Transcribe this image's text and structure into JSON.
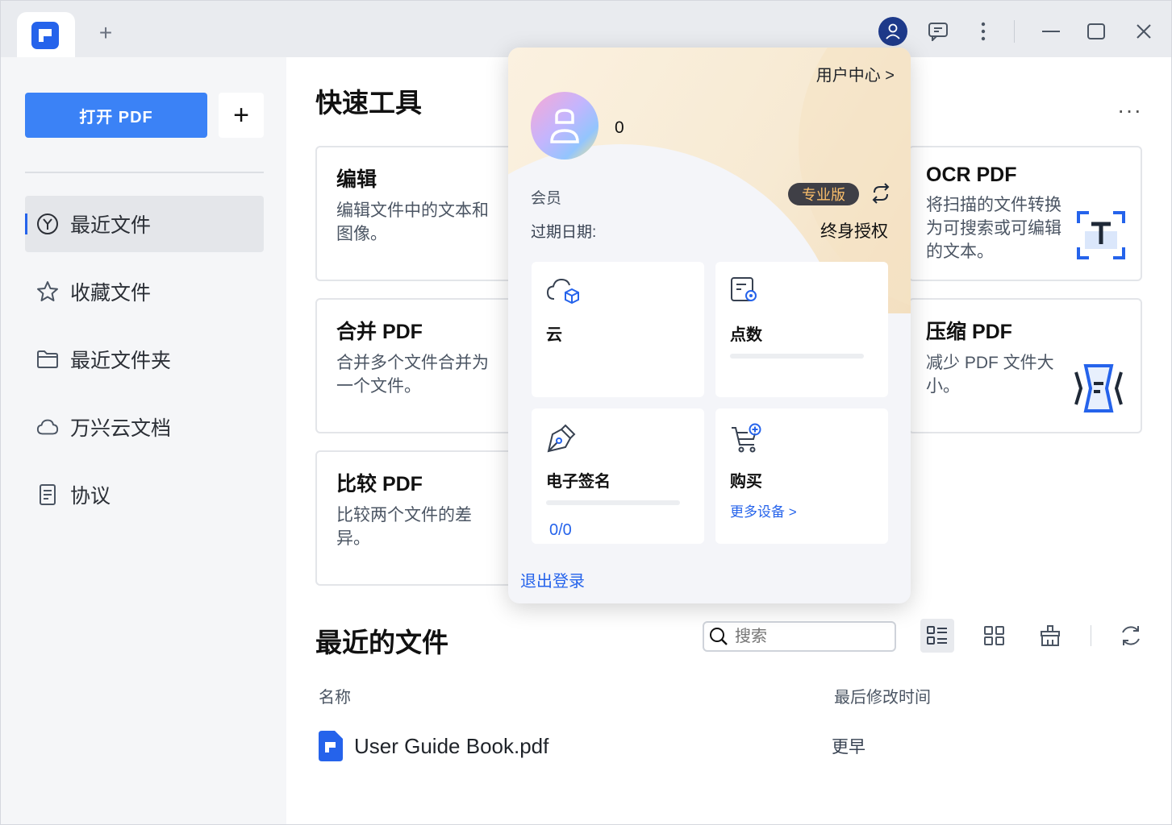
{
  "titlebar": {
    "new_tab_label": "+",
    "icons": [
      "user-icon",
      "feedback-icon",
      "more-vertical-icon",
      "minimize-icon",
      "maximize-icon",
      "close-icon"
    ]
  },
  "sidebar": {
    "open_pdf": "打开 PDF",
    "add": "+",
    "items": [
      {
        "label": "最近文件",
        "icon": "clock-icon",
        "active": true
      },
      {
        "label": "收藏文件",
        "icon": "star-icon"
      },
      {
        "label": "最近文件夹",
        "icon": "folder-icon"
      },
      {
        "label": "万兴云文档",
        "icon": "cloud-icon"
      },
      {
        "label": "协议",
        "icon": "document-icon"
      }
    ]
  },
  "quick_tools": {
    "title": "快速工具",
    "more": "···",
    "cards": [
      {
        "title": "编辑",
        "desc": "编辑文件中的文本和图像。"
      },
      {
        "title": "合并 PDF",
        "desc": "合并多个文件合并为一个文件。"
      },
      {
        "title": "比较 PDF",
        "desc": "比较两个文件的差异。"
      },
      {
        "title": "OCR PDF",
        "desc": "将扫描的文件转换为可搜索或可编辑的文本。"
      },
      {
        "title": "压缩 PDF",
        "desc": "减少 PDF 文件大小。"
      }
    ]
  },
  "recent": {
    "title": "最近的文件",
    "search_placeholder": "搜索",
    "columns": {
      "name": "名称",
      "modified": "最后修改时间"
    },
    "files": [
      {
        "name": "User Guide Book.pdf",
        "modified": "更早"
      }
    ]
  },
  "popup": {
    "user_center": "用户中心 >",
    "user_id": "0",
    "member_label": "会员",
    "member_badge": "专业版",
    "expiry_label": "过期日期:",
    "expiry_value": "终身授权",
    "tiles": [
      {
        "label": "云",
        "icon": "cloud-box-icon"
      },
      {
        "label": "点数",
        "icon": "points-icon"
      },
      {
        "label": "电子签名",
        "icon": "pen-nib-icon",
        "usage": "0/0"
      },
      {
        "label": "购买",
        "icon": "cart-plus-icon",
        "link": "更多设备 >"
      }
    ],
    "logout": "退出登录"
  },
  "colors": {
    "accent": "#3b82f6",
    "badge_bg": "#3f3f46",
    "badge_text": "#fbbf6b",
    "link": "#2563eb"
  }
}
